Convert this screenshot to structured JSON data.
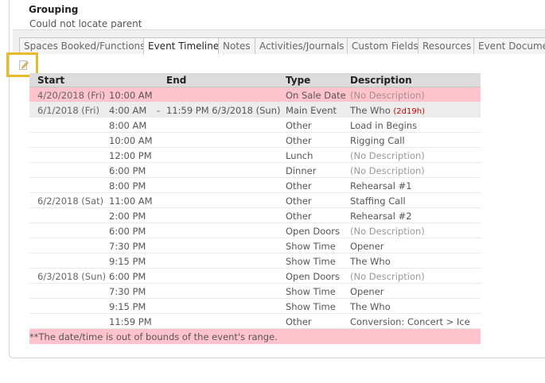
{
  "grouping": {
    "title": "Grouping",
    "message": "Could not locate parent"
  },
  "tabs": [
    {
      "label": "Spaces Booked/Functions",
      "active": false
    },
    {
      "label": "Event Timeline",
      "active": true
    },
    {
      "label": "Notes",
      "active": false
    },
    {
      "label": "Activities/Journals",
      "active": false
    },
    {
      "label": "Custom Fields",
      "active": false
    },
    {
      "label": "Resources",
      "active": false
    },
    {
      "label": "Event Documen",
      "active": false
    }
  ],
  "edit_icon": "pencil-edit-icon",
  "accent_color": "#e8b92a",
  "highlight_color": "#fec3cc",
  "timeline": {
    "columns": {
      "start": "Start",
      "end": "End",
      "type": "Type",
      "description": "Description"
    },
    "rows": [
      {
        "date": "4/20/2018 (Fri)",
        "time": "10:00 AM",
        "dash": "",
        "end": "",
        "type": "On Sale Date",
        "description": "(No Description)",
        "duration": "",
        "style": "pink"
      },
      {
        "date": "6/1/2018 (Fri)",
        "time": "4:00 AM",
        "dash": "-",
        "end": "11:59 PM  6/3/2018 (Sun)",
        "type": "Main Event",
        "description": "The Who",
        "duration": "(2d19h)",
        "style": "gray"
      },
      {
        "date": "",
        "time": "8:00 AM",
        "dash": "",
        "end": "",
        "type": "Other",
        "description": "Load in Begins",
        "duration": "",
        "style": ""
      },
      {
        "date": "",
        "time": "10:00 AM",
        "dash": "",
        "end": "",
        "type": "Other",
        "description": "Rigging Call",
        "duration": "",
        "style": ""
      },
      {
        "date": "",
        "time": "12:00 PM",
        "dash": "",
        "end": "",
        "type": "Lunch",
        "description": "(No Description)",
        "duration": "",
        "style": ""
      },
      {
        "date": "",
        "time": "6:00 PM",
        "dash": "",
        "end": "",
        "type": "Dinner",
        "description": "(No Description)",
        "duration": "",
        "style": ""
      },
      {
        "date": "",
        "time": "8:00 PM",
        "dash": "",
        "end": "",
        "type": "Other",
        "description": "Rehearsal #1",
        "duration": "",
        "style": ""
      },
      {
        "date": "6/2/2018 (Sat)",
        "time": "11:00 AM",
        "dash": "",
        "end": "",
        "type": "Other",
        "description": "Staffing Call",
        "duration": "",
        "style": ""
      },
      {
        "date": "",
        "time": "2:00 PM",
        "dash": "",
        "end": "",
        "type": "Other",
        "description": "Rehearsal #2",
        "duration": "",
        "style": ""
      },
      {
        "date": "",
        "time": "6:00 PM",
        "dash": "",
        "end": "",
        "type": "Open Doors",
        "description": "(No Description)",
        "duration": "",
        "style": ""
      },
      {
        "date": "",
        "time": "7:30 PM",
        "dash": "",
        "end": "",
        "type": "Show Time",
        "description": "Opener",
        "duration": "",
        "style": ""
      },
      {
        "date": "",
        "time": "9:15 PM",
        "dash": "",
        "end": "",
        "type": "Show Time",
        "description": "The Who",
        "duration": "",
        "style": ""
      },
      {
        "date": "6/3/2018 (Sun)",
        "time": "6:00 PM",
        "dash": "",
        "end": "",
        "type": "Open Doors",
        "description": "(No Description)",
        "duration": "",
        "style": ""
      },
      {
        "date": "",
        "time": "7:30 PM",
        "dash": "",
        "end": "",
        "type": "Show Time",
        "description": "Opener",
        "duration": "",
        "style": ""
      },
      {
        "date": "",
        "time": "9:15 PM",
        "dash": "",
        "end": "",
        "type": "Show Time",
        "description": "The Who",
        "duration": "",
        "style": ""
      },
      {
        "date": "",
        "time": "11:59 PM",
        "dash": "",
        "end": "",
        "type": "Other",
        "description": "Conversion: Concert > Ice",
        "duration": "",
        "style": ""
      }
    ],
    "footnote": "**The date/time is out of bounds of the event's range."
  }
}
